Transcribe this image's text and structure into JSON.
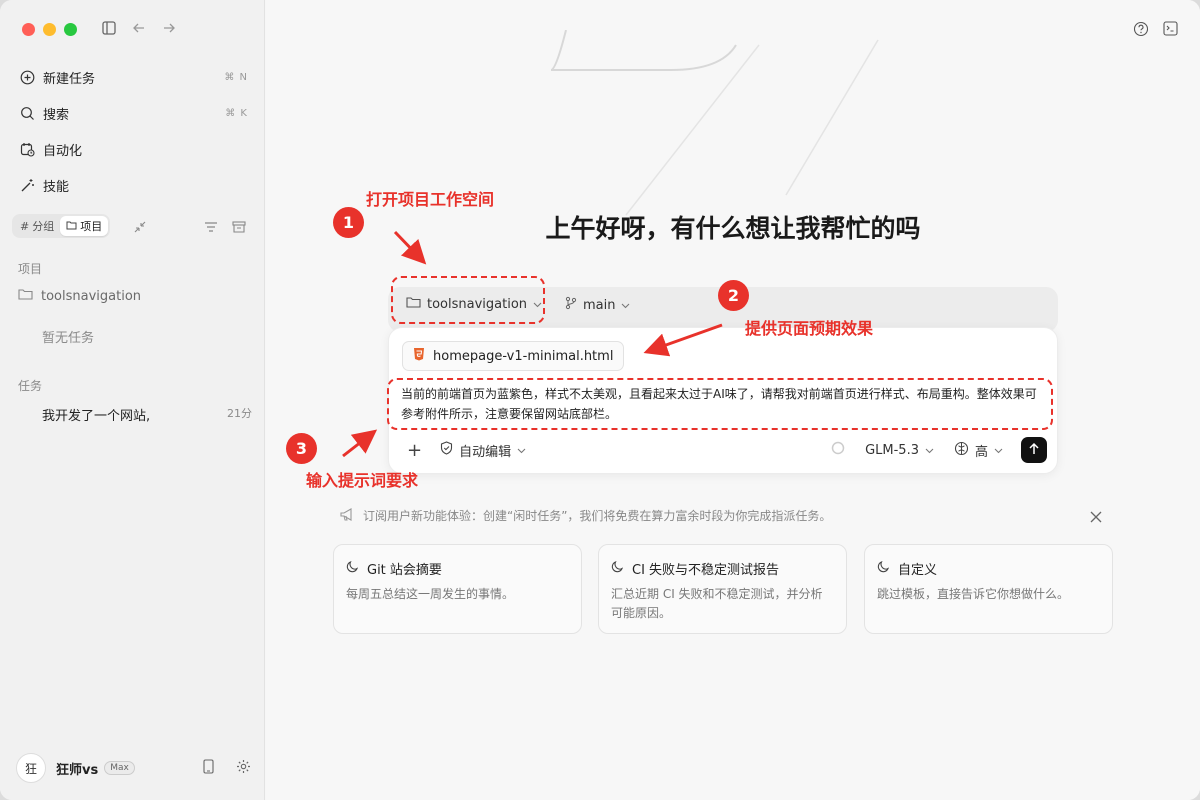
{
  "sidebar": {
    "nav": [
      {
        "label": "新建任务",
        "shortcut": "⌘ N",
        "icon": "plus-circle-icon"
      },
      {
        "label": "搜索",
        "shortcut": "⌘ K",
        "icon": "search-icon"
      },
      {
        "label": "自动化",
        "shortcut": "",
        "icon": "calendar-clock-icon"
      },
      {
        "label": "技能",
        "shortcut": "",
        "icon": "magic-wand-icon"
      }
    ],
    "segment": {
      "group": "分组",
      "project": "项目"
    },
    "projects_label": "项目",
    "project_name": "toolsnavigation",
    "empty_tasks": "暂无任务",
    "tasks_label": "任务",
    "task": {
      "title": "我开发了一个网站,",
      "time": "21分"
    },
    "user": {
      "avatar": "狂",
      "name": "狂师vs",
      "plan": "Max"
    }
  },
  "main": {
    "greeting": "上午好呀，有什么想让我帮忙的吗",
    "workspace": "toolsnavigation",
    "branch": "main",
    "attachment": "homepage-v1-minimal.html",
    "prompt": "当前的前端首页为蓝紫色，样式不太美观，且看起来太过于AI味了，请帮我对前端首页进行样式、布局重构。整体效果可参考附件所示，注意要保留网站底部栏。",
    "toolbar": {
      "add": "+",
      "mode": "自动编辑",
      "model": "GLM-5.3",
      "level": "高"
    },
    "notice": "订阅用户新功能体验：创建“闲时任务”，我们将免费在算力富余时段为你完成指派任务。",
    "templates": [
      {
        "title": "Git 站会摘要",
        "desc": "每周五总结这一周发生的事情。"
      },
      {
        "title": "CI 失败与不稳定测试报告",
        "desc": "汇总近期 CI 失败和不稳定测试，并分析可能原因。"
      },
      {
        "title": "自定义",
        "desc": "跳过模板，直接告诉它你想做什么。"
      }
    ]
  },
  "annotations": [
    {
      "num": "1",
      "label": "打开项目工作空间"
    },
    {
      "num": "2",
      "label": "提供页面预期效果"
    },
    {
      "num": "3",
      "label": "输入提示词要求"
    }
  ],
  "colors": {
    "accent": "#e8322b",
    "send": "#111111",
    "html_icon": "#e8642c"
  }
}
